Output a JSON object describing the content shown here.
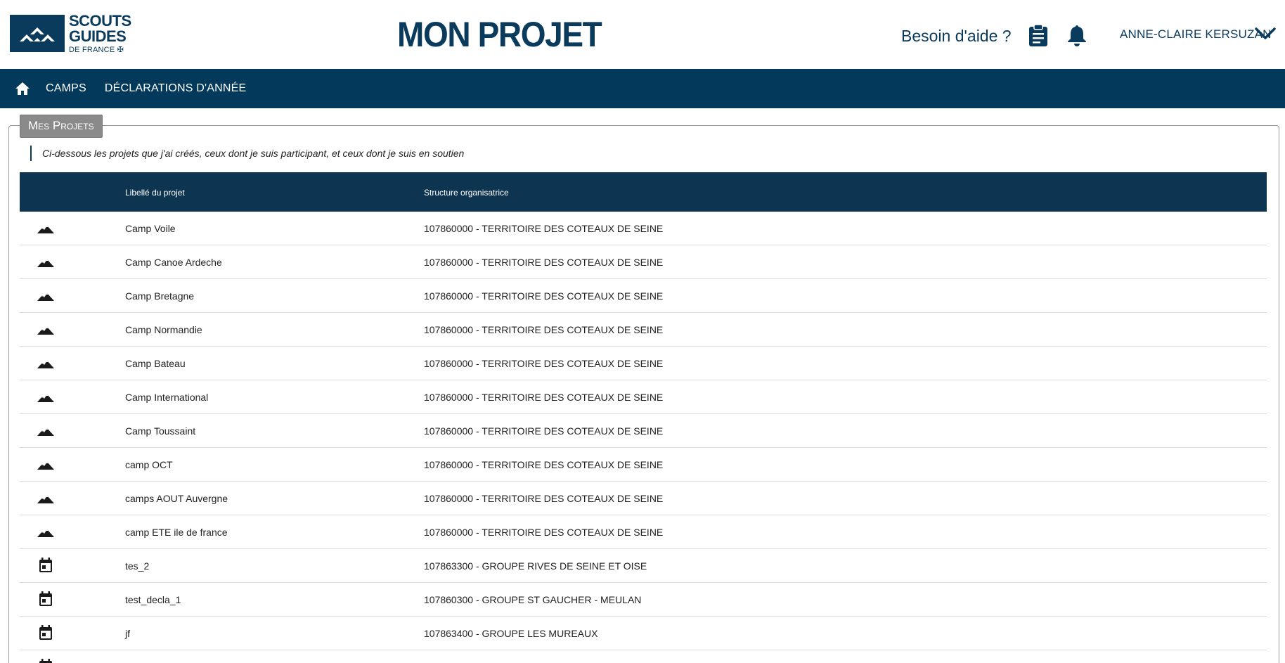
{
  "header": {
    "logo": {
      "line1": "SCOUTS",
      "line2": "GUIDES",
      "line3": "DE FRANCE ✠"
    },
    "title": "MON PROJET",
    "help": "Besoin d'aide ?",
    "user": "ANNE-CLAIRE KERSUZAN"
  },
  "nav": {
    "items": [
      "CAMPS",
      "DÉCLARATIONS D'ANNÉE"
    ]
  },
  "panel": {
    "legend": "Mes Projets",
    "intro": "Ci-dessous les projets que j'ai créés, ceux dont je suis participant, et ceux dont je suis en soutien"
  },
  "table": {
    "columns": [
      "Libellé du projet",
      "Structure organisatrice"
    ],
    "rows": [
      {
        "icon": "mountain-icon",
        "label": "Camp Voile",
        "structure": "107860000 - TERRITOIRE DES COTEAUX DE SEINE"
      },
      {
        "icon": "mountain-icon",
        "label": "Camp Canoe Ardeche",
        "structure": "107860000 - TERRITOIRE DES COTEAUX DE SEINE"
      },
      {
        "icon": "mountain-icon",
        "label": "Camp Bretagne",
        "structure": "107860000 - TERRITOIRE DES COTEAUX DE SEINE"
      },
      {
        "icon": "mountain-icon",
        "label": "Camp Normandie",
        "structure": "107860000 - TERRITOIRE DES COTEAUX DE SEINE"
      },
      {
        "icon": "mountain-icon",
        "label": "Camp Bateau",
        "structure": "107860000 - TERRITOIRE DES COTEAUX DE SEINE"
      },
      {
        "icon": "mountain-icon",
        "label": "Camp International",
        "structure": "107860000 - TERRITOIRE DES COTEAUX DE SEINE"
      },
      {
        "icon": "mountain-icon",
        "label": "Camp Toussaint",
        "structure": "107860000 - TERRITOIRE DES COTEAUX DE SEINE"
      },
      {
        "icon": "mountain-icon",
        "label": "camp OCT",
        "structure": "107860000 - TERRITOIRE DES COTEAUX DE SEINE"
      },
      {
        "icon": "mountain-icon",
        "label": "camps AOUT Auvergne",
        "structure": "107860000 - TERRITOIRE DES COTEAUX DE SEINE"
      },
      {
        "icon": "mountain-icon",
        "label": "camp ETE ile de france",
        "structure": "107860000 - TERRITOIRE DES COTEAUX DE SEINE"
      },
      {
        "icon": "calendar-icon",
        "label": "tes_2",
        "structure": "107863300 - GROUPE RIVES DE SEINE ET OISE"
      },
      {
        "icon": "calendar-icon",
        "label": "test_decla_1",
        "structure": "107860300 - GROUPE ST GAUCHER - MEULAN"
      },
      {
        "icon": "calendar-icon",
        "label": "jf",
        "structure": "107863400 - GROUPE LES MUREAUX"
      },
      {
        "icon": "calendar-icon",
        "label": "",
        "structure": ""
      }
    ]
  },
  "colors": {
    "brand": "#0a3a5c",
    "navbar": "#033a5c",
    "table_header": "#0d3551",
    "legend_bg": "#8a8a8a"
  }
}
